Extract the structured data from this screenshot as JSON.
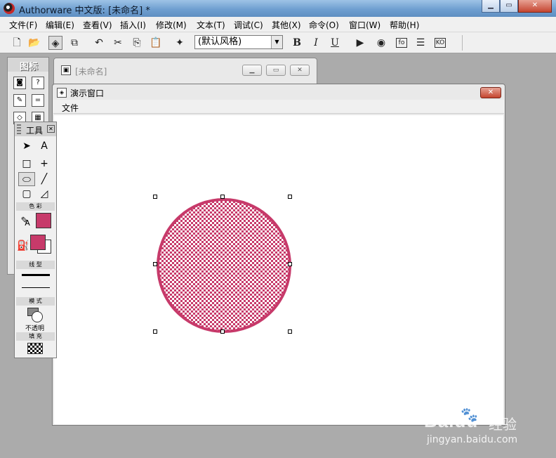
{
  "app": {
    "title": "Authorware 中文版: [未命名] *"
  },
  "menu": [
    "文件(F)",
    "编辑(E)",
    "查看(V)",
    "插入(I)",
    "修改(M)",
    "文本(T)",
    "调试(C)",
    "其他(X)",
    "命令(O)",
    "窗口(W)",
    "帮助(H)"
  ],
  "toolbar": {
    "style_select": "(默认风格)",
    "bold": "B",
    "italic": "I",
    "underline": "U",
    "fo": "fo",
    "ko": "KO"
  },
  "flow_window": {
    "title": "[未命名]"
  },
  "presentation": {
    "title": "演示窗口",
    "menu_file": "文件"
  },
  "icon_palette": {
    "title": "图标"
  },
  "tools_palette": {
    "title": "工具",
    "section_color": "色 彩",
    "section_linetype": "线 型",
    "section_mode": "模 式",
    "mode_value": "不透明",
    "section_fill": "填 充",
    "text_tool": "A",
    "color_text": "A"
  },
  "drawing": {
    "shape": "ellipse",
    "fill_pattern": "checker",
    "color": "#c73a6a"
  },
  "watermark": {
    "brand": "Baidu",
    "brand_cn": "经验",
    "url": "jingyan.baidu.com"
  }
}
